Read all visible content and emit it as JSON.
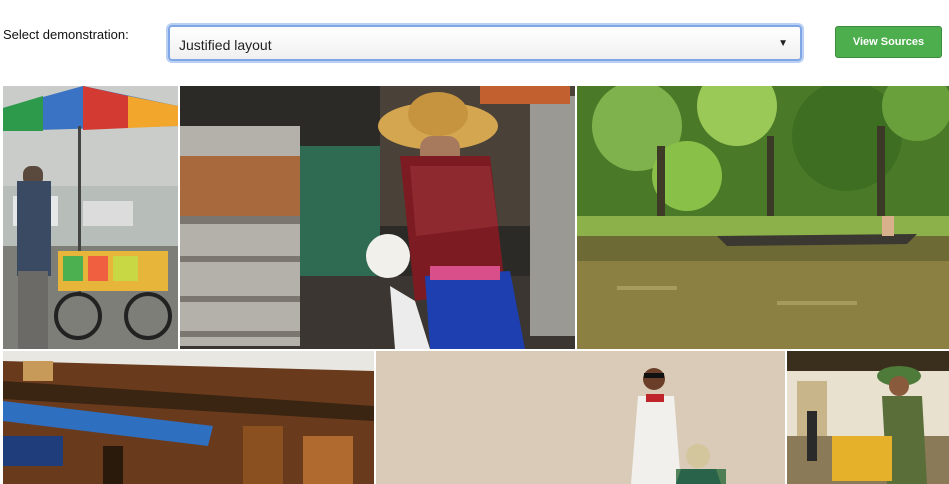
{
  "controls": {
    "label": "Select demonstration:",
    "selected_value": "Justified layout",
    "button_label": "View Sources"
  },
  "gallery": {
    "photos": [
      {
        "subject": "street vendor under umbrella in rain"
      },
      {
        "subject": "woman in straw hat with steamer baskets"
      },
      {
        "subject": "boat on jungle river"
      },
      {
        "subject": "wooden building with blue awning"
      },
      {
        "subject": "man in white shirt and sunglasses"
      },
      {
        "subject": "man in green helmet at street cart"
      }
    ]
  },
  "colors": {
    "button": "#4cae4c",
    "select_focus": "#7fa7e6"
  }
}
